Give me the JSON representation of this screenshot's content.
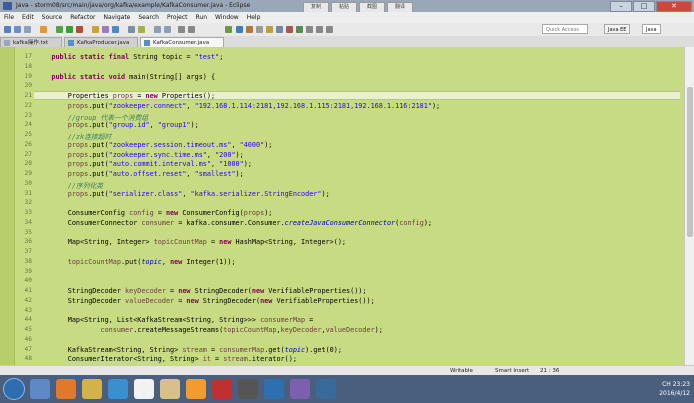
{
  "window": {
    "title": "Java - storm08/src/main/java/org/kafka/example/KafkaConsumer.java - Eclipse"
  },
  "overlay_buttons": [
    "复制",
    "粘贴",
    "截图",
    "翻译"
  ],
  "menu": [
    "File",
    "Edit",
    "Source",
    "Refactor",
    "Navigate",
    "Search",
    "Project",
    "Run",
    "Window",
    "Help"
  ],
  "toolbar": {
    "quick_access": "Quick Access",
    "perspectives": [
      "Java EE",
      "Java"
    ]
  },
  "tabs": [
    {
      "label": "kafka操作.txt",
      "active": false
    },
    {
      "label": "KafkaProducer.java",
      "active": false
    },
    {
      "label": "KafkaConsumer.java",
      "active": true
    }
  ],
  "editor": {
    "current_line": 21,
    "lines": [
      {
        "n": 17,
        "segs": [
          [
            "    ",
            ""
          ],
          [
            "public static final ",
            "kw"
          ],
          [
            "String ",
            ""
          ],
          [
            "topic",
            ""
          ],
          [
            " = ",
            ""
          ],
          [
            "\"test\"",
            "str"
          ],
          [
            ";",
            ""
          ]
        ]
      },
      {
        "n": 18,
        "segs": []
      },
      {
        "n": 19,
        "segs": [
          [
            "    ",
            ""
          ],
          [
            "public static void ",
            "kw"
          ],
          [
            "main(String[] args) {",
            ""
          ]
        ]
      },
      {
        "n": 20,
        "segs": []
      },
      {
        "n": 21,
        "segs": [
          [
            "        Properties ",
            ""
          ],
          [
            "props",
            "var"
          ],
          [
            " = ",
            ""
          ],
          [
            "new ",
            "kw"
          ],
          [
            "Properties();",
            ""
          ]
        ]
      },
      {
        "n": 22,
        "segs": [
          [
            "        props",
            "var"
          ],
          [
            ".put(",
            ""
          ],
          [
            "\"zookeeper.connect\"",
            "str"
          ],
          [
            ", ",
            ""
          ],
          [
            "\"192.168.1.114:2181,192.168.1.115:2181,192.168.1.116:2181\"",
            "str"
          ],
          [
            ");",
            ""
          ]
        ]
      },
      {
        "n": 23,
        "segs": [
          [
            "        //group 代表一个消费组",
            "cm"
          ]
        ]
      },
      {
        "n": 24,
        "segs": [
          [
            "        props",
            "var"
          ],
          [
            ".put(",
            ""
          ],
          [
            "\"group.id\"",
            "str"
          ],
          [
            ", ",
            ""
          ],
          [
            "\"group1\"",
            "str"
          ],
          [
            ");",
            ""
          ]
        ]
      },
      {
        "n": 25,
        "segs": [
          [
            "        //zk连接超时",
            "cm"
          ]
        ]
      },
      {
        "n": 26,
        "segs": [
          [
            "        props",
            "var"
          ],
          [
            ".put(",
            ""
          ],
          [
            "\"zookeeper.session.timeout.ms\"",
            "str"
          ],
          [
            ", ",
            ""
          ],
          [
            "\"4000\"",
            "str"
          ],
          [
            ");",
            ""
          ]
        ]
      },
      {
        "n": 27,
        "segs": [
          [
            "        props",
            "var"
          ],
          [
            ".put(",
            ""
          ],
          [
            "\"zookeeper.sync.time.ms\"",
            "str"
          ],
          [
            ", ",
            ""
          ],
          [
            "\"200\"",
            "str"
          ],
          [
            ");",
            ""
          ]
        ]
      },
      {
        "n": 28,
        "segs": [
          [
            "        props",
            "var"
          ],
          [
            ".put(",
            ""
          ],
          [
            "\"auto.commit.interval.ms\"",
            "str"
          ],
          [
            ", ",
            ""
          ],
          [
            "\"1000\"",
            "str"
          ],
          [
            ");",
            ""
          ]
        ]
      },
      {
        "n": 29,
        "segs": [
          [
            "        props",
            "var"
          ],
          [
            ".put(",
            ""
          ],
          [
            "\"auto.offset.reset\"",
            "str"
          ],
          [
            ", ",
            ""
          ],
          [
            "\"smallest\"",
            "str"
          ],
          [
            ");",
            ""
          ]
        ]
      },
      {
        "n": 30,
        "segs": [
          [
            "        //序列化类",
            "cm"
          ]
        ]
      },
      {
        "n": 31,
        "segs": [
          [
            "        props",
            "var"
          ],
          [
            ".put(",
            ""
          ],
          [
            "\"serializer.class\"",
            "str"
          ],
          [
            ", ",
            ""
          ],
          [
            "\"kafka.serializer.StringEncoder\"",
            "str"
          ],
          [
            ");",
            ""
          ]
        ]
      },
      {
        "n": 32,
        "segs": []
      },
      {
        "n": 33,
        "segs": [
          [
            "        ConsumerConfig ",
            ""
          ],
          [
            "config",
            "var"
          ],
          [
            " = ",
            ""
          ],
          [
            "new ",
            "kw"
          ],
          [
            "ConsumerConfig(",
            ""
          ],
          [
            "props",
            "var"
          ],
          [
            ");",
            ""
          ]
        ]
      },
      {
        "n": 34,
        "segs": [
          [
            "        ConsumerConnector ",
            ""
          ],
          [
            "consumer",
            "var"
          ],
          [
            " = kafka.consumer.Consumer.",
            ""
          ],
          [
            "createJavaConsumerConnector",
            "fld"
          ],
          [
            "(",
            ""
          ],
          [
            "config",
            "var"
          ],
          [
            ");",
            ""
          ]
        ]
      },
      {
        "n": 35,
        "segs": []
      },
      {
        "n": 36,
        "segs": [
          [
            "        Map<String, Integer> ",
            ""
          ],
          [
            "topicCountMap",
            "var"
          ],
          [
            " = ",
            ""
          ],
          [
            "new ",
            "kw"
          ],
          [
            "HashMap<String, Integer>();",
            ""
          ]
        ]
      },
      {
        "n": 37,
        "segs": []
      },
      {
        "n": 38,
        "segs": [
          [
            "        topicCountMap",
            "var"
          ],
          [
            ".put(",
            ""
          ],
          [
            "topic",
            "fld"
          ],
          [
            ", ",
            ""
          ],
          [
            "new ",
            "kw"
          ],
          [
            "Integer(1));",
            ""
          ]
        ]
      },
      {
        "n": 39,
        "segs": []
      },
      {
        "n": 40,
        "segs": []
      },
      {
        "n": 41,
        "segs": [
          [
            "        StringDecoder ",
            ""
          ],
          [
            "keyDecoder",
            "var"
          ],
          [
            " = ",
            ""
          ],
          [
            "new ",
            "kw"
          ],
          [
            "StringDecoder(",
            ""
          ],
          [
            "new ",
            "kw"
          ],
          [
            "VerifiableProperties());",
            ""
          ]
        ]
      },
      {
        "n": 42,
        "segs": [
          [
            "        StringDecoder ",
            ""
          ],
          [
            "valueDecoder",
            "var"
          ],
          [
            " = ",
            ""
          ],
          [
            "new ",
            "kw"
          ],
          [
            "StringDecoder(",
            ""
          ],
          [
            "new ",
            "kw"
          ],
          [
            "VerifiableProperties());",
            ""
          ]
        ]
      },
      {
        "n": 43,
        "segs": []
      },
      {
        "n": 44,
        "segs": [
          [
            "        Map<String, List<KafkaStream<String, String>>> ",
            ""
          ],
          [
            "consumerMap",
            "var"
          ],
          [
            " =",
            ""
          ]
        ]
      },
      {
        "n": 45,
        "segs": [
          [
            "                consumer",
            "var"
          ],
          [
            ".createMessageStreams(",
            ""
          ],
          [
            "topicCountMap",
            "var"
          ],
          [
            ",",
            ""
          ],
          [
            "keyDecoder",
            "var"
          ],
          [
            ",",
            ""
          ],
          [
            "valueDecoder",
            "var"
          ],
          [
            ");",
            ""
          ]
        ]
      },
      {
        "n": 46,
        "segs": []
      },
      {
        "n": 47,
        "segs": [
          [
            "        KafkaStream<String, String> ",
            ""
          ],
          [
            "stream",
            "var"
          ],
          [
            " = ",
            ""
          ],
          [
            "consumerMap",
            "var"
          ],
          [
            ".get(",
            ""
          ],
          [
            "topic",
            "fld"
          ],
          [
            ").get(0);",
            ""
          ]
        ]
      },
      {
        "n": 48,
        "segs": [
          [
            "        ConsumerIterator<String, String> ",
            ""
          ],
          [
            "it",
            "var"
          ],
          [
            " = ",
            ""
          ],
          [
            "stream",
            "var"
          ],
          [
            ".iterator();",
            ""
          ]
        ]
      }
    ]
  },
  "status": {
    "mode": "Writable",
    "insert": "Smart Insert",
    "position": "21 : 36"
  },
  "tray": {
    "time": "23:23",
    "date": "2016/4/12",
    "lang": "CH"
  }
}
